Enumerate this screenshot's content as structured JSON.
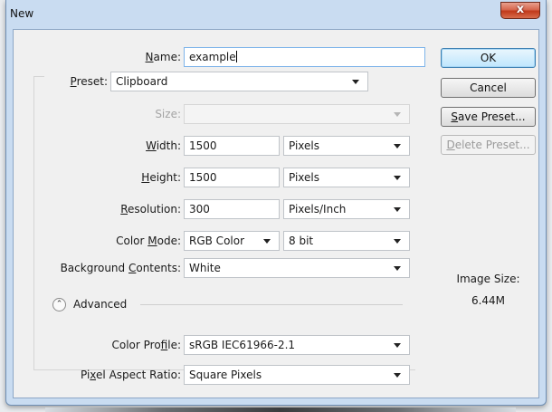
{
  "window": {
    "title": "New",
    "close_glyph": "x"
  },
  "form": {
    "name": {
      "label_pre": "",
      "label_key": "N",
      "label_post": "ame:",
      "value": "example"
    },
    "preset": {
      "label_key": "P",
      "label_post": "reset:",
      "value": "Clipboard"
    },
    "size": {
      "label": "Size:",
      "value": ""
    },
    "width": {
      "label_key": "W",
      "label_post": "idth:",
      "value": "1500",
      "unit": "Pixels"
    },
    "height": {
      "label_key": "H",
      "label_post": "eight:",
      "value": "1500",
      "unit": "Pixels"
    },
    "resolution": {
      "label_key": "R",
      "label_post": "esolution:",
      "value": "300",
      "unit": "Pixels/Inch"
    },
    "color_mode": {
      "label_pre": "Color ",
      "label_key": "M",
      "label_post": "ode:",
      "value": "RGB Color",
      "depth": "8 bit"
    },
    "background": {
      "label_pre": "Background ",
      "label_key": "C",
      "label_post": "ontents:",
      "value": "White"
    },
    "advanced": {
      "label": "Advanced",
      "icon_glyph": "⌃"
    },
    "color_profile": {
      "label_pre": "Color Pro",
      "label_key": "f",
      "label_post": "ile:",
      "value": "sRGB IEC61966-2.1"
    },
    "pixel_aspect": {
      "label_pre": "Pi",
      "label_key": "x",
      "label_post": "el Aspect Ratio:",
      "value": "Square Pixels"
    }
  },
  "buttons": {
    "ok": "OK",
    "cancel": "Cancel",
    "save_preset_key": "S",
    "save_preset_rest": "ave Preset...",
    "delete_preset_key": "D",
    "delete_preset_rest": "elete Preset..."
  },
  "image_size": {
    "label": "Image Size:",
    "value": "6.44M"
  }
}
